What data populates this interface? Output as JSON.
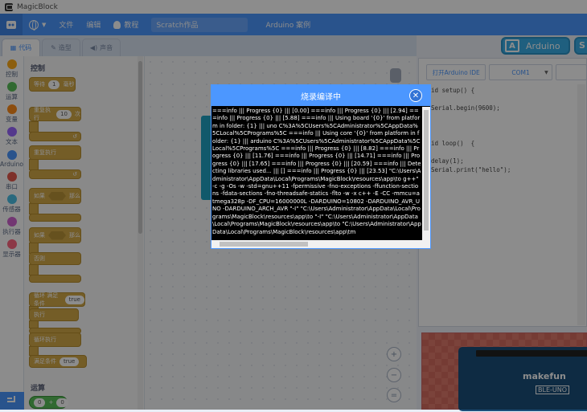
{
  "app": {
    "title": "MagicBlock"
  },
  "menu": {
    "file": "文件",
    "edit": "编辑",
    "tutorial": "教程",
    "project_name": "Scratch作品",
    "arduino_example": "Arduino 案例"
  },
  "tabs": [
    {
      "label": "代码"
    },
    {
      "label": "造型"
    },
    {
      "label": "声音"
    }
  ],
  "categories": [
    {
      "label": "控制",
      "color": "#ffab19"
    },
    {
      "label": "运算",
      "color": "#59c059"
    },
    {
      "label": "变量",
      "color": "#ff8c1a"
    },
    {
      "label": "文本",
      "color": "#9966ff"
    },
    {
      "label": "Arduino",
      "color": "#4c97ff"
    },
    {
      "label": "串口",
      "color": "#e65a4d"
    },
    {
      "label": "传感器",
      "color": "#4cbfe6"
    },
    {
      "label": "执行器",
      "color": "#cf63cf"
    },
    {
      "label": "显示器",
      "color": "#ff6680"
    }
  ],
  "palette": {
    "section_title": "控制",
    "wait_label": "等待",
    "wait_value": "1",
    "wait_unit": "毫秒",
    "repeat_label": "重复执行",
    "repeat_value": "10",
    "repeat_unit": "次",
    "forever_label": "重复执行",
    "if_label": "如果",
    "then_label": "那么",
    "if2_label": "如果",
    "then2_label": "那么",
    "else_label": "否则",
    "loop_cond_label": "循环 满足条件",
    "loop_cond_value": "true",
    "exec_label": "执行",
    "loop_exec_label": "循环执行",
    "cond_label": "满足条件",
    "cond_value": "true",
    "bottom_section": "运算",
    "op_left": "0",
    "op_sign": "+",
    "op_right": "0"
  },
  "right": {
    "arduino_label": "Arduino",
    "open_ide": "打开Arduino IDE",
    "port": "COM1",
    "code_lines": [
      "id setup() {",
      "",
      "Serial.begin(9600);",
      "",
      "",
      "",
      "id loop()  {",
      "",
      "delay(1);",
      "Serial.print(\"hello\");"
    ],
    "board_brand": "makefun",
    "board_name": "BLE-UNO"
  },
  "modal": {
    "title": "烧录编译中",
    "log": "===info ||| Progress {0} ||| [0.00] ===info ||| Progress {0} ||| [2.94] ===info ||| Progress {0} ||| [5.88] ===info ||| Using board '{0}' from platform in folder: {1} ||| uno C%3A%5CUsers%5CAdministrator%5CAppData%5CLocal%5CPrograms%5C ===info ||| Using core '{0}' from platform in folder: {1} ||| arduino C%3A%5CUsers%5CAdministrator%5CAppData%5CLocal%5CPrograms%5C ===info ||| Progress {0} ||| [8.82] ===info ||| Progress {0} ||| [11.76] ===info ||| Progress {0} ||| [14.71] ===info ||| Progress {0} ||| [17.65] ===info ||| Progress {0} ||| [20.59] ===info ||| Detecting libraries used... ||| [] ===info ||| Progress {0} ||| [23.53] \"C:\\Users\\Administrator\\AppData\\Local\\Programs\\MagicBlock\\resources\\app\\to g++\" -c -g -Os -w -std=gnu++11 -fpermissive -fno-exceptions -ffunction-sections -fdata-sections -fno-threadsafe-statics -flto -w -x c++ -E -CC -mmcu=atmega328p -DF_CPU=16000000L -DARDUINO=10802 -DARDUINO_AVR_UNO -DARDUINO_ARCH_AVR \"-I\" \"C:\\Users\\Administrator\\AppData\\Local\\Programs\\MagicBlock\\resources\\app\\to \"-I\" \"C:\\Users\\Administrator\\AppData\\Local\\Programs\\MagicBlock\\resources\\app\\to \"C:\\Users\\Administrator\\AppData\\Local\\Programs\\MagicBlock\\resources\\app\\tm"
  }
}
